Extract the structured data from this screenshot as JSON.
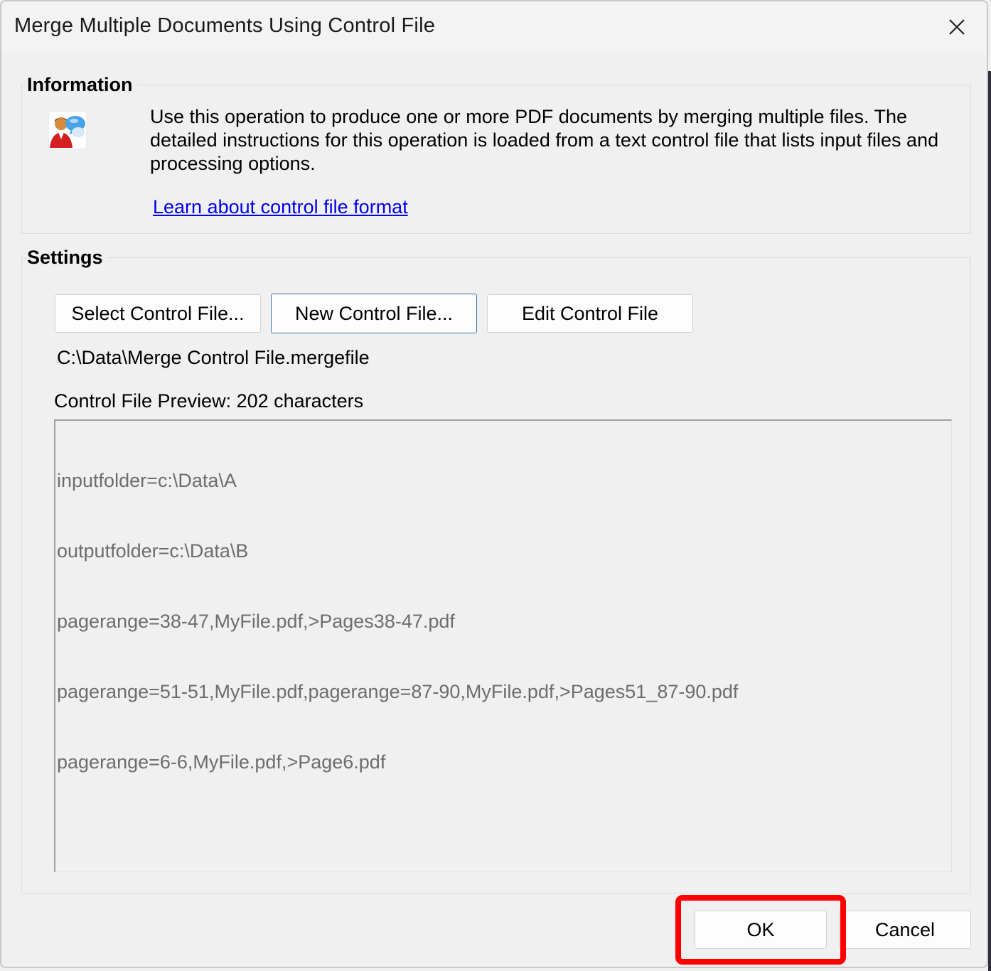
{
  "window": {
    "title": "Merge Multiple Documents Using Control File"
  },
  "information": {
    "label": "Information",
    "icon": "users-chat-icon",
    "text": "Use this operation to produce one or more PDF documents by merging multiple files. The detailed instructions for this operation is loaded from a text control file that lists input files and processing options.",
    "link": "Learn about control file format"
  },
  "settings": {
    "label": "Settings",
    "buttons": {
      "select": "Select Control File...",
      "new": "New Control File...",
      "edit": "Edit Control File"
    },
    "path": "C:\\Data\\Merge Control File.mergefile",
    "preview_label": "Control File Preview: 202 characters",
    "preview_lines": [
      "inputfolder=c:\\Data\\A",
      "outputfolder=c:\\Data\\B",
      "pagerange=38-47,MyFile.pdf,>Pages38-47.pdf",
      "pagerange=51-51,MyFile.pdf,pagerange=87-90,MyFile.pdf,>Pages51_87-90.pdf",
      "pagerange=6-6,MyFile.pdf,>Page6.pdf"
    ]
  },
  "footer": {
    "ok": "OK",
    "cancel": "Cancel"
  },
  "colors": {
    "highlight": "#ff0000",
    "link": "#0000ee"
  }
}
